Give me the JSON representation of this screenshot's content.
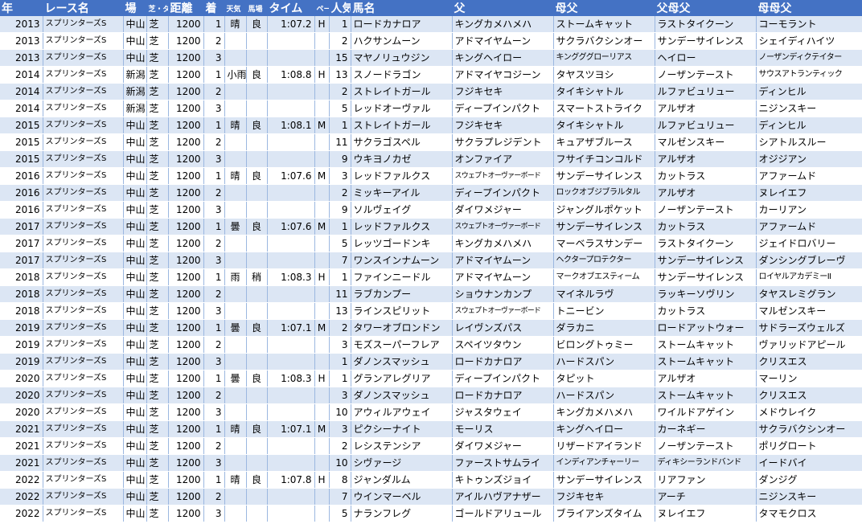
{
  "headers": {
    "year": "年",
    "race": "レース名",
    "venue": "場",
    "surface": "芝・ダ",
    "distance": "距離",
    "rank": "着",
    "weather": "天気",
    "going": "馬場",
    "time": "タイム",
    "pace": "ペース",
    "popularity": "人気",
    "horse": "馬名",
    "sire": "父",
    "damsire": "母父",
    "sire_sire": "父母父",
    "dam_damsire": "母母父"
  },
  "rows": [
    [
      "2013",
      "スプリンターズS",
      "中山",
      "芝",
      "1200",
      "1",
      "晴",
      "良",
      "1:07.2",
      "H",
      "1",
      "ロードカナロア",
      "キングカメハメハ",
      "ストームキャット",
      "ラストタイクーン",
      "コーモラント"
    ],
    [
      "2013",
      "スプリンターズS",
      "中山",
      "芝",
      "1200",
      "2",
      "",
      "",
      "",
      "",
      "2",
      "ハクサンムーン",
      "アドマイヤムーン",
      "サクラバクシンオー",
      "サンデーサイレンス",
      "シェイディハイツ"
    ],
    [
      "2013",
      "スプリンターズS",
      "中山",
      "芝",
      "1200",
      "3",
      "",
      "",
      "",
      "",
      "15",
      "マヤノリュウジン",
      "キングヘイロー",
      "キングググローリアス",
      "ヘイロー",
      "ノーザンディクテイター"
    ],
    [
      "2014",
      "スプリンターズS",
      "新潟",
      "芝",
      "1200",
      "1",
      "小雨",
      "良",
      "1:08.8",
      "H",
      "13",
      "スノードラゴン",
      "アドマイヤコジーン",
      "タヤスツヨシ",
      "ノーザンテースト",
      "サウスアトランティック"
    ],
    [
      "2014",
      "スプリンターズS",
      "新潟",
      "芝",
      "1200",
      "2",
      "",
      "",
      "",
      "",
      "2",
      "ストレイトガール",
      "フジキセキ",
      "タイキシャトル",
      "ルファビュリュー",
      "ディンヒル"
    ],
    [
      "2014",
      "スプリンターズS",
      "新潟",
      "芝",
      "1200",
      "3",
      "",
      "",
      "",
      "",
      "5",
      "レッドオーヴァル",
      "ディープインパクト",
      "スマートストライク",
      "アルザオ",
      "ニジンスキー"
    ],
    [
      "2015",
      "スプリンターズS",
      "中山",
      "芝",
      "1200",
      "1",
      "晴",
      "良",
      "1:08.1",
      "M",
      "1",
      "ストレイトガール",
      "フジキセキ",
      "タイキシャトル",
      "ルファビュリュー",
      "ディンヒル"
    ],
    [
      "2015",
      "スプリンターズS",
      "中山",
      "芝",
      "1200",
      "2",
      "",
      "",
      "",
      "",
      "11",
      "サクラゴスペル",
      "サクラプレジデント",
      "キュアザブルース",
      "マルゼンスキー",
      "シアトルスルー"
    ],
    [
      "2015",
      "スプリンターズS",
      "中山",
      "芝",
      "1200",
      "3",
      "",
      "",
      "",
      "",
      "9",
      "ウキヨノカゼ",
      "オンファイア",
      "フサイチコンコルド",
      "アルザオ",
      "オジジアン"
    ],
    [
      "2016",
      "スプリンターズS",
      "中山",
      "芝",
      "1200",
      "1",
      "晴",
      "良",
      "1:07.6",
      "M",
      "3",
      "レッドファルクス",
      "スウェプトオーヴァーボード",
      "サンデーサイレンス",
      "カットラス",
      "アファームド"
    ],
    [
      "2016",
      "スプリンターズS",
      "中山",
      "芝",
      "1200",
      "2",
      "",
      "",
      "",
      "",
      "2",
      "ミッキーアイル",
      "ディープインパクト",
      "ロックオブジブラルタル",
      "アルザオ",
      "ヌレイエフ"
    ],
    [
      "2016",
      "スプリンターズS",
      "中山",
      "芝",
      "1200",
      "3",
      "",
      "",
      "",
      "",
      "9",
      "ソルヴェイグ",
      "ダイワメジャー",
      "ジャングルポケット",
      "ノーザンテースト",
      "カーリアン"
    ],
    [
      "2017",
      "スプリンターズS",
      "中山",
      "芝",
      "1200",
      "1",
      "曇",
      "良",
      "1:07.6",
      "M",
      "1",
      "レッドファルクス",
      "スウェプトオーヴァーボード",
      "サンデーサイレンス",
      "カットラス",
      "アファームド"
    ],
    [
      "2017",
      "スプリンターズS",
      "中山",
      "芝",
      "1200",
      "2",
      "",
      "",
      "",
      "",
      "5",
      "レッツゴードンキ",
      "キングカメハメハ",
      "マーベラスサンデー",
      "ラストタイクーン",
      "ジェイドロバリー"
    ],
    [
      "2017",
      "スプリンターズS",
      "中山",
      "芝",
      "1200",
      "3",
      "",
      "",
      "",
      "",
      "7",
      "ワンスインナムーン",
      "アドマイヤムーン",
      "ヘクタープロテクター",
      "サンデーサイレンス",
      "ダンシングブレーヴ"
    ],
    [
      "2018",
      "スプリンターズS",
      "中山",
      "芝",
      "1200",
      "1",
      "雨",
      "稍",
      "1:08.3",
      "H",
      "1",
      "ファインニードル",
      "アドマイヤムーン",
      "マークオブエスティーム",
      "サンデーサイレンス",
      "ロイヤルアカデミーII"
    ],
    [
      "2018",
      "スプリンターズS",
      "中山",
      "芝",
      "1200",
      "2",
      "",
      "",
      "",
      "",
      "11",
      "ラブカンプー",
      "ショウナンカンプ",
      "マイネルラヴ",
      "ラッキーソヴリン",
      "タヤスレミグラン"
    ],
    [
      "2018",
      "スプリンターズS",
      "中山",
      "芝",
      "1200",
      "3",
      "",
      "",
      "",
      "",
      "13",
      "ラインスピリット",
      "スウェプトオーヴァーボード",
      "トニービン",
      "カットラス",
      "マルゼンスキー"
    ],
    [
      "2019",
      "スプリンターズS",
      "中山",
      "芝",
      "1200",
      "1",
      "曇",
      "良",
      "1:07.1",
      "M",
      "2",
      "タワーオブロンドン",
      "レイヴンズパス",
      "ダラカニ",
      "ロードアットウォー",
      "サドラーズウェルズ"
    ],
    [
      "2019",
      "スプリンターズS",
      "中山",
      "芝",
      "1200",
      "2",
      "",
      "",
      "",
      "",
      "3",
      "モズスーパーフレア",
      "スペイツタウン",
      "ビロングトゥミー",
      "ストームキャット",
      "ヴァリッドアピール"
    ],
    [
      "2019",
      "スプリンターズS",
      "中山",
      "芝",
      "1200",
      "3",
      "",
      "",
      "",
      "",
      "1",
      "ダノンスマッシュ",
      "ロードカナロア",
      "ハードスパン",
      "ストームキャット",
      "クリスエス"
    ],
    [
      "2020",
      "スプリンターズS",
      "中山",
      "芝",
      "1200",
      "1",
      "曇",
      "良",
      "1:08.3",
      "H",
      "1",
      "グランアレグリア",
      "ディープインパクト",
      "タピット",
      "アルザオ",
      "マーリン"
    ],
    [
      "2020",
      "スプリンターズS",
      "中山",
      "芝",
      "1200",
      "2",
      "",
      "",
      "",
      "",
      "3",
      "ダノンスマッシュ",
      "ロードカナロア",
      "ハードスパン",
      "ストームキャット",
      "クリスエス"
    ],
    [
      "2020",
      "スプリンターズS",
      "中山",
      "芝",
      "1200",
      "3",
      "",
      "",
      "",
      "",
      "10",
      "アウィルアウェイ",
      "ジャスタウェイ",
      "キングカメハメハ",
      "ワイルドアゲイン",
      "メドウレイク"
    ],
    [
      "2021",
      "スプリンターズS",
      "中山",
      "芝",
      "1200",
      "1",
      "晴",
      "良",
      "1:07.1",
      "M",
      "3",
      "ピクシーナイト",
      "モーリス",
      "キングヘイロー",
      "カーネギー",
      "サクラバクシンオー"
    ],
    [
      "2021",
      "スプリンターズS",
      "中山",
      "芝",
      "1200",
      "2",
      "",
      "",
      "",
      "",
      "2",
      "レシステンシア",
      "ダイワメジャー",
      "リザードアイランド",
      "ノーザンテースト",
      "ポリグロート"
    ],
    [
      "2021",
      "スプリンターズS",
      "中山",
      "芝",
      "1200",
      "3",
      "",
      "",
      "",
      "",
      "10",
      "シヴァージ",
      "ファーストサムライ",
      "インディアンチャーリー",
      "ディキシーランドバンド",
      "イードバイ"
    ],
    [
      "2022",
      "スプリンターズS",
      "中山",
      "芝",
      "1200",
      "1",
      "晴",
      "良",
      "1:07.8",
      "H",
      "8",
      "ジャンダルム",
      "キトゥンズジョイ",
      "サンデーサイレンス",
      "リアファン",
      "ダンジグ"
    ],
    [
      "2022",
      "スプリンターズS",
      "中山",
      "芝",
      "1200",
      "2",
      "",
      "",
      "",
      "",
      "7",
      "ウインマーベル",
      "アイルハヴアナザー",
      "フジキセキ",
      "アーチ",
      "ニジンスキー"
    ],
    [
      "2022",
      "スプリンターズS",
      "中山",
      "芝",
      "1200",
      "3",
      "",
      "",
      "",
      "",
      "5",
      "ナランフレグ",
      "ゴールドアリュール",
      "ブライアンズタイム",
      "ヌレイエフ",
      "タマモクロス"
    ]
  ]
}
